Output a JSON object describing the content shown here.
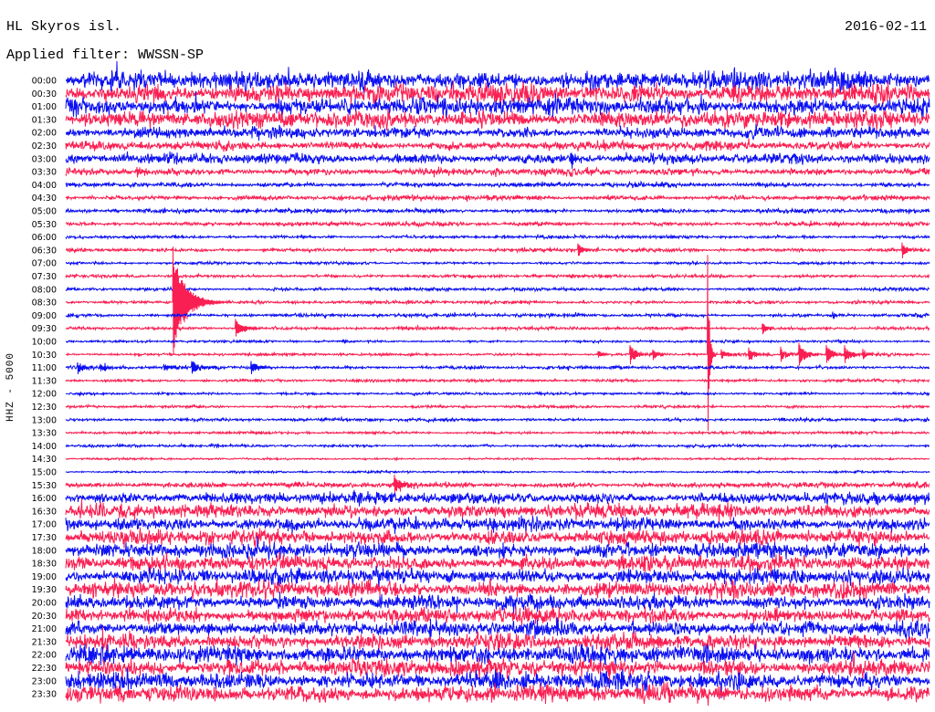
{
  "chart_data": {
    "type": "line",
    "title": "HL Skyros isl.",
    "subtitle": "Applied filter: WWSSN-SP",
    "date": "2016-02-11",
    "xlabel": "",
    "ylabel": "HHZ - 5000",
    "grid": false,
    "colors": [
      "#0c10f2",
      "#fa1f52"
    ],
    "lines": [
      {
        "label": "00:00",
        "noise": 3200
      },
      {
        "label": "00:30",
        "noise": 3200
      },
      {
        "label": "01:00",
        "noise": 3000
      },
      {
        "label": "01:30",
        "noise": 2900
      },
      {
        "label": "02:00",
        "noise": 1800
      },
      {
        "label": "02:30",
        "noise": 1500
      },
      {
        "label": "03:00",
        "noise": 1700
      },
      {
        "label": "03:30",
        "noise": 1200
      },
      {
        "label": "04:00",
        "noise": 800
      },
      {
        "label": "04:30",
        "noise": 800
      },
      {
        "label": "05:00",
        "noise": 700
      },
      {
        "label": "05:30",
        "noise": 700
      },
      {
        "label": "06:00",
        "noise": 550
      },
      {
        "label": "06:30",
        "noise": 600
      },
      {
        "label": "07:00",
        "noise": 450
      },
      {
        "label": "07:30",
        "noise": 550
      },
      {
        "label": "08:00",
        "noise": 550
      },
      {
        "label": "08:30",
        "noise": 550
      },
      {
        "label": "09:00",
        "noise": 600
      },
      {
        "label": "09:30",
        "noise": 550
      },
      {
        "label": "10:00",
        "noise": 400
      },
      {
        "label": "10:30",
        "noise": 450
      },
      {
        "label": "11:00",
        "noise": 550
      },
      {
        "label": "11:30",
        "noise": 500
      },
      {
        "label": "12:00",
        "noise": 450
      },
      {
        "label": "12:30",
        "noise": 450
      },
      {
        "label": "13:00",
        "noise": 500
      },
      {
        "label": "13:30",
        "noise": 450
      },
      {
        "label": "14:00",
        "noise": 450
      },
      {
        "label": "14:30",
        "noise": 350
      },
      {
        "label": "15:00",
        "noise": 350
      },
      {
        "label": "15:30",
        "noise": 900
      },
      {
        "label": "16:00",
        "noise": 1900
      },
      {
        "label": "16:30",
        "noise": 2300
      },
      {
        "label": "17:00",
        "noise": 2300
      },
      {
        "label": "17:30",
        "noise": 2500
      },
      {
        "label": "18:00",
        "noise": 2500
      },
      {
        "label": "18:30",
        "noise": 2500
      },
      {
        "label": "19:00",
        "noise": 2500
      },
      {
        "label": "19:30",
        "noise": 2700
      },
      {
        "label": "20:00",
        "noise": 2500
      },
      {
        "label": "20:30",
        "noise": 2500
      },
      {
        "label": "21:00",
        "noise": 2500
      },
      {
        "label": "21:30",
        "noise": 2700
      },
      {
        "label": "22:00",
        "noise": 2900
      },
      {
        "label": "22:30",
        "noise": 3000
      },
      {
        "label": "23:00",
        "noise": 2900
      },
      {
        "label": "23:30",
        "noise": 3000
      }
    ],
    "events": [
      {
        "time": "03:17:32",
        "amplitude": 2400,
        "duration_s": 30
      },
      {
        "time": "03:32:28",
        "amplitude": 1800,
        "duration_s": 40
      },
      {
        "time": "06:47:47",
        "amplitude": 2800,
        "duration_s": 24
      },
      {
        "time": "06:59:03",
        "amplitude": 2800,
        "duration_s": 24
      },
      {
        "time": "08:33:44",
        "amplitude": 21000,
        "duration_s": 55
      },
      {
        "time": "09:26:38",
        "amplitude": 1500,
        "duration_s": 14
      },
      {
        "time": "09:35:54",
        "amplitude": 3500,
        "duration_s": 36
      },
      {
        "time": "09:54:12",
        "amplitude": 2100,
        "duration_s": 26
      },
      {
        "time": "10:48:29",
        "amplitude": 1500,
        "duration_s": 20
      },
      {
        "time": "10:49:36",
        "amplitude": 3600,
        "duration_s": 30
      },
      {
        "time": "10:50:23",
        "amplitude": 2000,
        "duration_s": 24
      },
      {
        "time": "10:52:18",
        "amplitude": 38000,
        "duration_s": 8
      },
      {
        "time": "10:52:46",
        "amplitude": 1800,
        "duration_s": 30
      },
      {
        "time": "10:53:43",
        "amplitude": 2400,
        "duration_s": 30
      },
      {
        "time": "10:54:50",
        "amplitude": 2800,
        "duration_s": 26
      },
      {
        "time": "10:55:28",
        "amplitude": 4500,
        "duration_s": 30
      },
      {
        "time": "10:56:25",
        "amplitude": 3600,
        "duration_s": 30
      },
      {
        "time": "10:57:03",
        "amplitude": 3400,
        "duration_s": 26
      },
      {
        "time": "10:57:41",
        "amplitude": 1800,
        "duration_s": 24
      },
      {
        "time": "11:00:25",
        "amplitude": 2200,
        "duration_s": 34
      },
      {
        "time": "11:01:12",
        "amplitude": 1400,
        "duration_s": 30
      },
      {
        "time": "11:03:25",
        "amplitude": 1500,
        "duration_s": 34
      },
      {
        "time": "11:04:23",
        "amplitude": 2600,
        "duration_s": 36
      },
      {
        "time": "11:06:26",
        "amplitude": 2200,
        "duration_s": 40
      },
      {
        "time": "15:41:25",
        "amplitude": 4200,
        "duration_s": 40
      }
    ]
  }
}
